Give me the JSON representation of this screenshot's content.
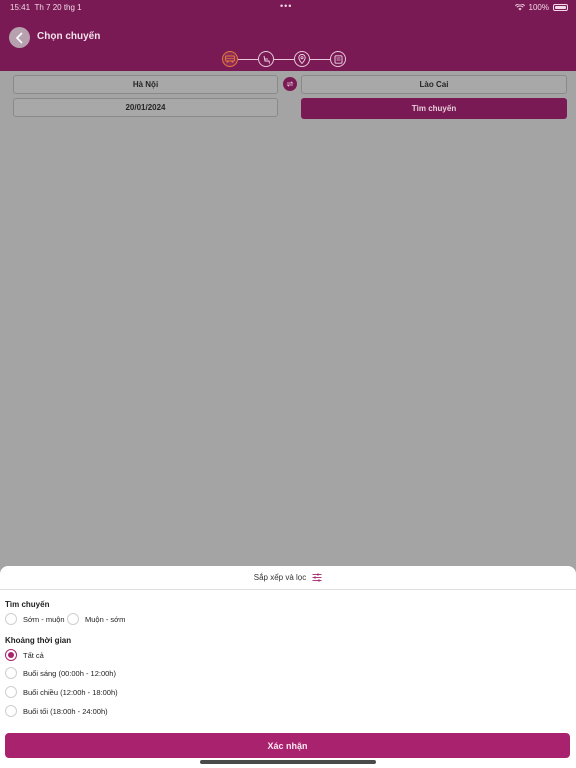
{
  "status_bar": {
    "time": "15:41",
    "date": "Th 7 20 thg 1",
    "battery": "100%",
    "dots": "•••"
  },
  "header": {
    "title": "Chọn chuyến"
  },
  "stepper": {
    "steps": [
      {
        "icon": "bus-icon",
        "active": true
      },
      {
        "icon": "seat-icon",
        "active": false
      },
      {
        "icon": "location-pin-icon",
        "active": false
      },
      {
        "icon": "ticket-icon",
        "active": false
      }
    ]
  },
  "search": {
    "origin": "Hà Nội",
    "destination": "Lào Cai",
    "date": "20/01/2024",
    "search_button": "Tìm chuyến"
  },
  "sheet": {
    "title": "Sắp xếp và lọc",
    "sort_section": {
      "title": "Tìm chuyến",
      "options": [
        "Sớm - muộn",
        "Muộn - sớm"
      ],
      "selected_index": -1
    },
    "time_section": {
      "title": "Khoảng thời gian",
      "options": [
        "Tất cả",
        "Buổi sáng (00:00h - 12:00h)",
        "Buổi chiều (12:00h - 18:00h)",
        "Buổi tối (18:00h - 24:00h)"
      ],
      "selected_index": 0
    },
    "confirm_button": "Xác nhận"
  },
  "colors": {
    "brand": "#7a1a55",
    "accent": "#a8226e"
  }
}
